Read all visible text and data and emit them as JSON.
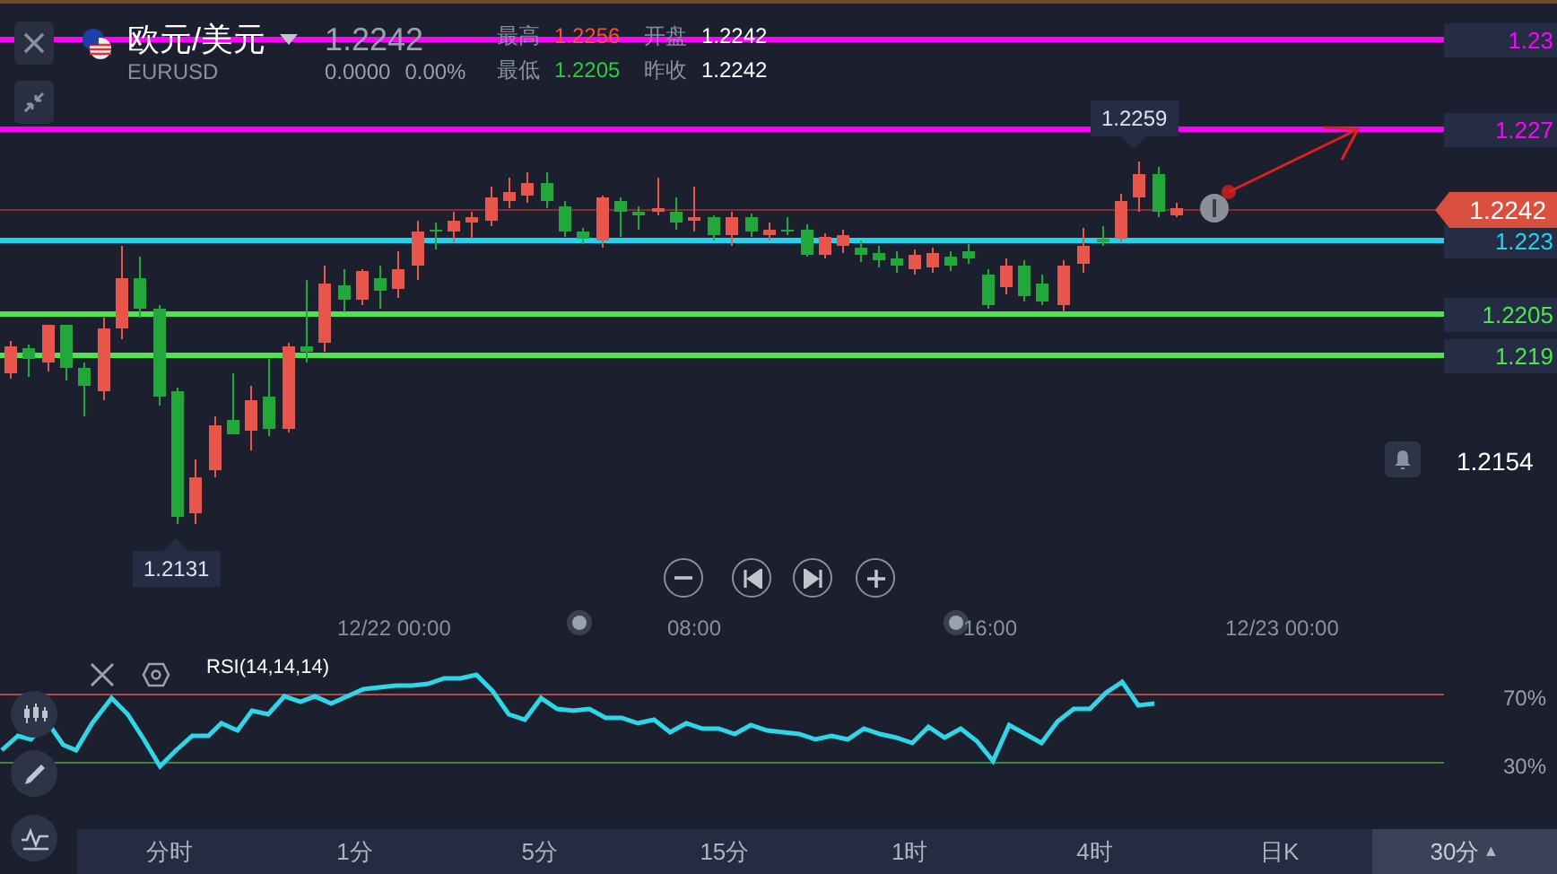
{
  "header": {
    "pair": "欧元/美元",
    "symbol": "EURUSD",
    "price": "1.2242",
    "change": "0.0000",
    "change_pct": "0.00%",
    "stats": [
      {
        "label": "最高",
        "value": "1.2256",
        "color": "#ff4d3d"
      },
      {
        "label": "开盘",
        "value": "1.2242",
        "color": "#ffffff"
      },
      {
        "label": "最低",
        "value": "1.2205",
        "color": "#2ecc40"
      },
      {
        "label": "昨收",
        "value": "1.2242",
        "color": "#ffffff"
      }
    ]
  },
  "chart": {
    "levels": [
      {
        "label": "1.23",
        "color": "#ff00ff"
      },
      {
        "label": "1.227",
        "color": "#ff00ff"
      },
      {
        "label": "1.223",
        "color": "#22d3ee"
      },
      {
        "label": "1.2205",
        "color": "#4ee44e"
      },
      {
        "label": "1.219",
        "color": "#4ee44e"
      }
    ],
    "current_price": "1.2242",
    "high_marker": "1.2259",
    "low_marker": "1.2131",
    "alert_price": "1.2154",
    "time_labels": [
      "12/22 00:00",
      "08:00",
      "16:00",
      "12/23 00:00"
    ]
  },
  "indicator": {
    "name": "RSI(14,14,14)",
    "upper": "70%",
    "lower": "30%"
  },
  "periods": [
    {
      "label": "分时",
      "selected": false
    },
    {
      "label": "1分",
      "selected": false
    },
    {
      "label": "5分",
      "selected": false
    },
    {
      "label": "15分",
      "selected": false
    },
    {
      "label": "1时",
      "selected": false
    },
    {
      "label": "4时",
      "selected": false
    },
    {
      "label": "日K",
      "selected": false
    },
    {
      "label": "30分",
      "caret": "▲",
      "selected": true
    }
  ]
}
